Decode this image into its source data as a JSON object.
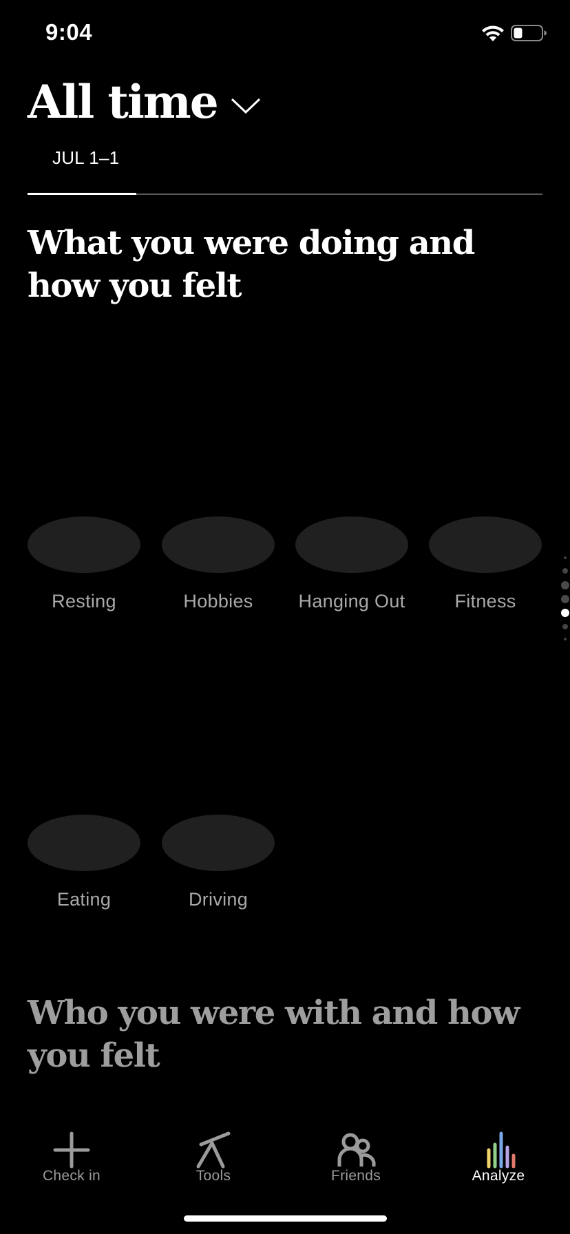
{
  "status_bar": {
    "time": "9:04"
  },
  "header": {
    "title": "All time",
    "date_range": "JUL 1–1",
    "range_progress": 0.21
  },
  "sections": {
    "doing": {
      "heading": "What you were doing and how you felt",
      "activities": [
        {
          "label": "Resting"
        },
        {
          "label": "Hobbies"
        },
        {
          "label": "Hanging Out"
        },
        {
          "label": "Fitness"
        },
        {
          "label": "Eating"
        },
        {
          "label": "Driving"
        }
      ]
    },
    "with": {
      "heading": "Who you were with and how you felt"
    }
  },
  "page_indicator": {
    "count": 7,
    "active_index": 4
  },
  "tab_bar": {
    "tabs": [
      {
        "label": "Check in",
        "icon": "plus-icon"
      },
      {
        "label": "Tools",
        "icon": "tools-icon"
      },
      {
        "label": "Friends",
        "icon": "friends-icon"
      },
      {
        "label": "Analyze",
        "icon": "analyze-icon",
        "active": true
      }
    ]
  },
  "colors": {
    "background": "#000000",
    "oval": "#202020",
    "muted_text": "#a9a9a9",
    "analyze_bars": [
      "#f1d36b",
      "#8fd18a",
      "#7aa7e8",
      "#e07a6b"
    ]
  }
}
